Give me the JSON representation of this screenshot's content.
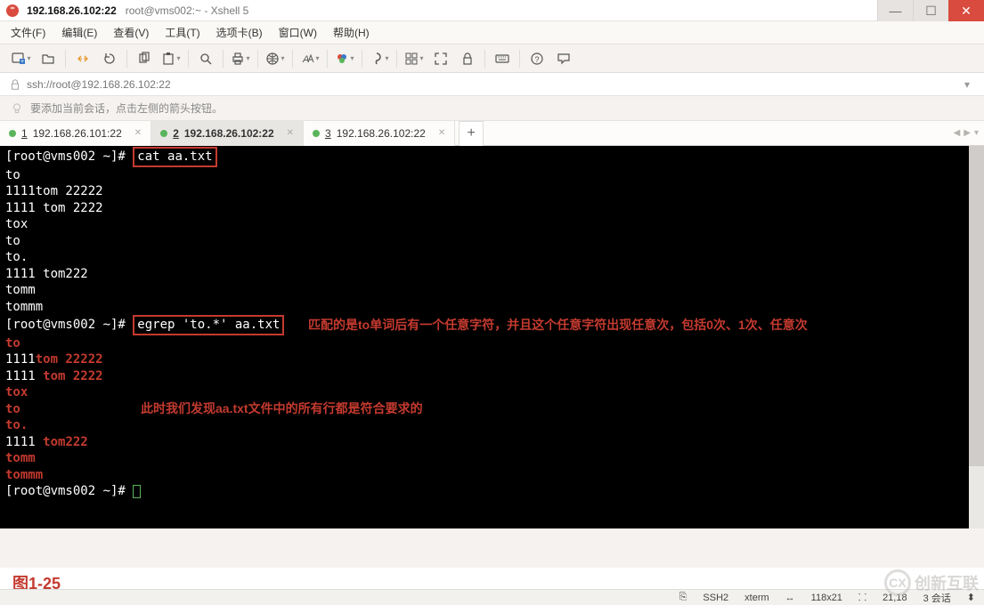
{
  "window": {
    "host": "192.168.26.102:22",
    "subtitle": "root@vms002:~ - Xshell 5",
    "min": "—",
    "max": "☐",
    "close": "✕"
  },
  "menu": {
    "file": "文件(F)",
    "edit": "编辑(E)",
    "view": "查看(V)",
    "tools": "工具(T)",
    "tabs": "选项卡(B)",
    "window": "窗口(W)",
    "help": "帮助(H)"
  },
  "address": {
    "url": "ssh://root@192.168.26.102:22"
  },
  "infobar": {
    "text": "要添加当前会话，点击左侧的箭头按钮。"
  },
  "tabs": {
    "items": [
      {
        "n": "1",
        "label": "192.168.26.101:22",
        "active": false
      },
      {
        "n": "2",
        "label": "192.168.26.102:22",
        "active": true
      },
      {
        "n": "3",
        "label": "192.168.26.102:22",
        "active": false
      }
    ],
    "add": "+"
  },
  "terminal": {
    "prompt": "[root@vms002 ~]# ",
    "cmd1": "cat aa.txt",
    "out1": [
      "to",
      "1111tom 22222",
      "1111 tom 2222",
      "tox",
      "to",
      "to.",
      "1111 tom222",
      "tomm",
      "tommm"
    ],
    "cmd2": "egrep 'to.*' aa.txt",
    "annot1": "匹配的是to单词后有一个任意字符，并且这个任意字符出现任意次，包括0次、1次、任意次",
    "out2": [
      {
        "pre": "",
        "m": "to",
        "post": ""
      },
      {
        "pre": "1111",
        "m": "tom 22222",
        "post": ""
      },
      {
        "pre": "1111 ",
        "m": "tom 2222",
        "post": ""
      },
      {
        "pre": "",
        "m": "tox",
        "post": ""
      },
      {
        "pre": "",
        "m": "to",
        "post": ""
      },
      {
        "pre": "",
        "m": "to.",
        "post": ""
      },
      {
        "pre": "1111 ",
        "m": "tom222",
        "post": ""
      },
      {
        "pre": "",
        "m": "tomm",
        "post": ""
      },
      {
        "pre": "",
        "m": "tommm",
        "post": ""
      }
    ],
    "annot2": "此时我们发现aa.txt文件中的所有行都是符合要求的"
  },
  "figure_label": "图1-25",
  "status": {
    "ssh": "SSH2",
    "term": "xterm",
    "size": "118x21",
    "pos": "21,18",
    "sessions": "3 会话",
    "arrows": "⬍"
  },
  "watermark": "创新互联"
}
